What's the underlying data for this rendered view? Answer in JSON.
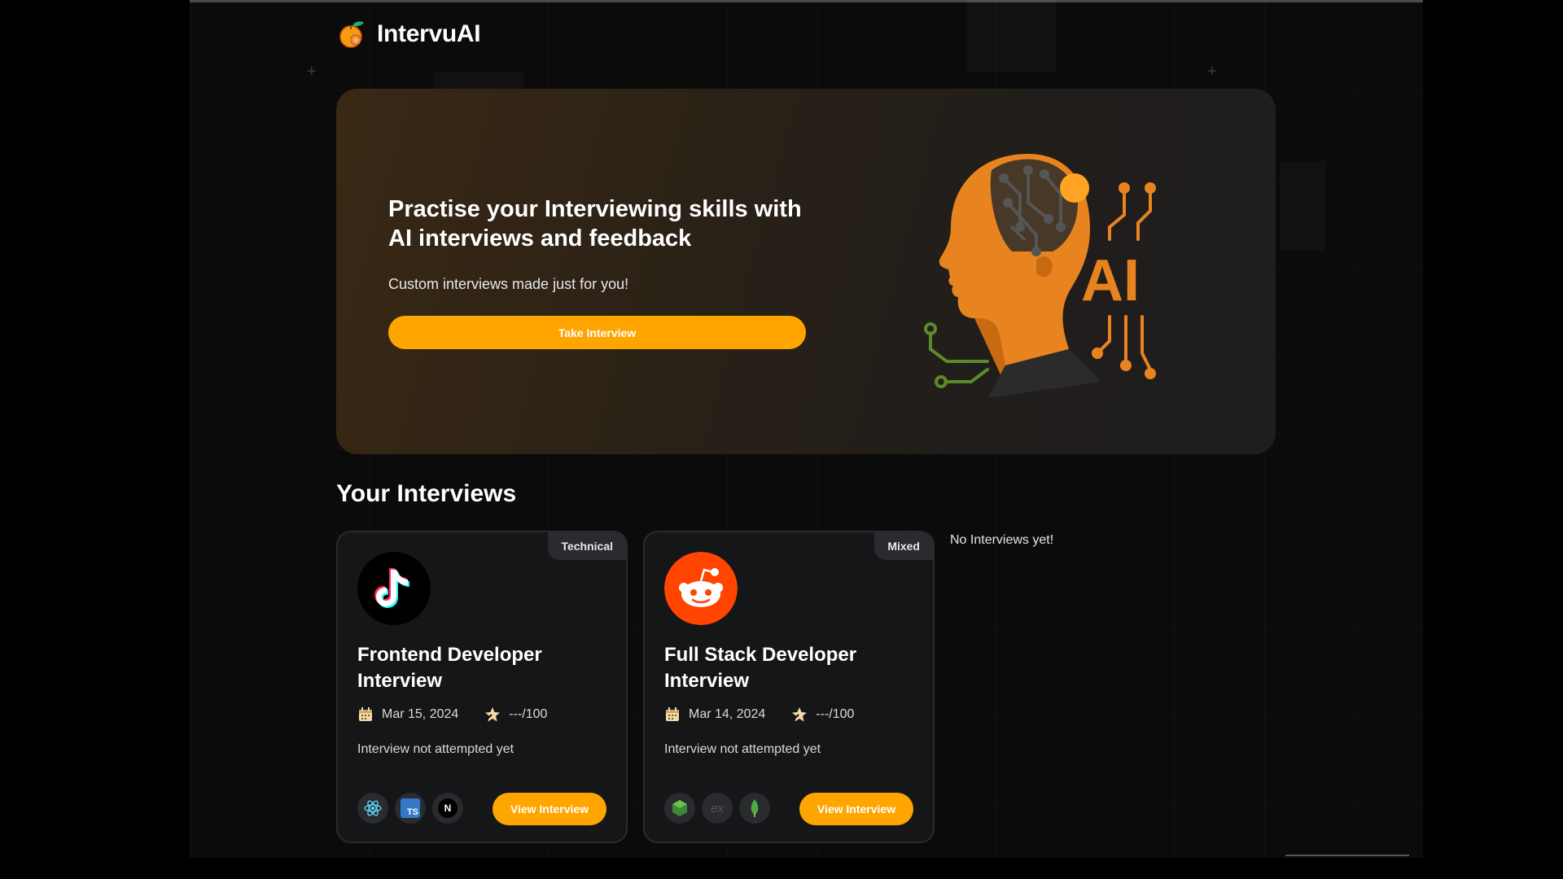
{
  "brand": {
    "name": "IntervuAI",
    "logo_icon": "orange-fruit-icon"
  },
  "hero": {
    "title": "Practise your Interviewing skills with AI interviews and feedback",
    "subtitle": "Custom interviews made just for you!",
    "button_label": "Take Interview",
    "art_icon": "ai-head-circuit-illustration",
    "art_text": "AI"
  },
  "section": {
    "title": "Your Interviews",
    "empty_text": "No Interviews yet!"
  },
  "interviews": [
    {
      "badge": "Technical",
      "logo_icon": "tiktok-logo-icon",
      "title": "Frontend Developer Interview",
      "date": "Mar 15, 2024",
      "score": "---/100",
      "description": "Interview not attempted yet",
      "techs": [
        "react-icon",
        "typescript-icon",
        "nextjs-icon"
      ],
      "tech_labels": {
        "ts": "TS",
        "next": "N"
      },
      "button_label": "View Interview"
    },
    {
      "badge": "Mixed",
      "logo_icon": "reddit-logo-icon",
      "title": "Full Stack Developer Interview",
      "date": "Mar 14, 2024",
      "score": "---/100",
      "description": "Interview not attempted yet",
      "techs": [
        "nodejs-icon",
        "express-icon",
        "mongodb-icon"
      ],
      "tech_labels": {
        "express": "ex"
      },
      "button_label": "View Interview"
    }
  ],
  "colors": {
    "accent": "#ffa500",
    "background": "#0b0b0c",
    "card": "#151618"
  }
}
